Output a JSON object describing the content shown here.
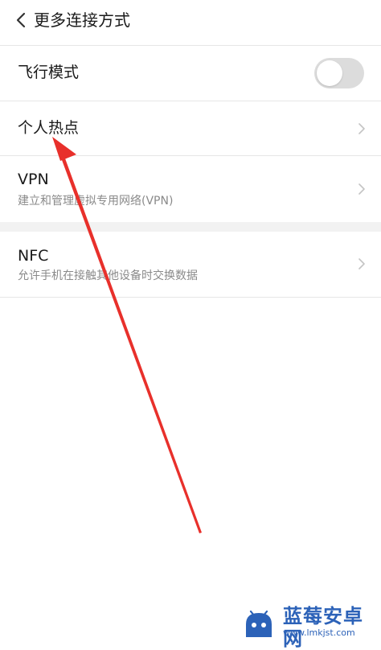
{
  "header": {
    "title": "更多连接方式"
  },
  "items": [
    {
      "title": "飞行模式",
      "toggle_on": false
    },
    {
      "title": "个人热点"
    },
    {
      "title": "VPN",
      "subtitle": "建立和管理虚拟专用网络(VPN)"
    },
    {
      "title": "NFC",
      "subtitle": "允许手机在接触其他设备时交换数据"
    }
  ],
  "icons": {
    "back": "chevron-left-icon",
    "chevron": "chevron-right-icon",
    "annotation": "red-arrow"
  },
  "colors": {
    "annotation": "#e8302b",
    "toggle_off": "#dcdcdc",
    "watermark": "#2c62b8"
  },
  "watermark": {
    "text": "蓝莓安卓网",
    "url": "www.lmkjst.com"
  }
}
